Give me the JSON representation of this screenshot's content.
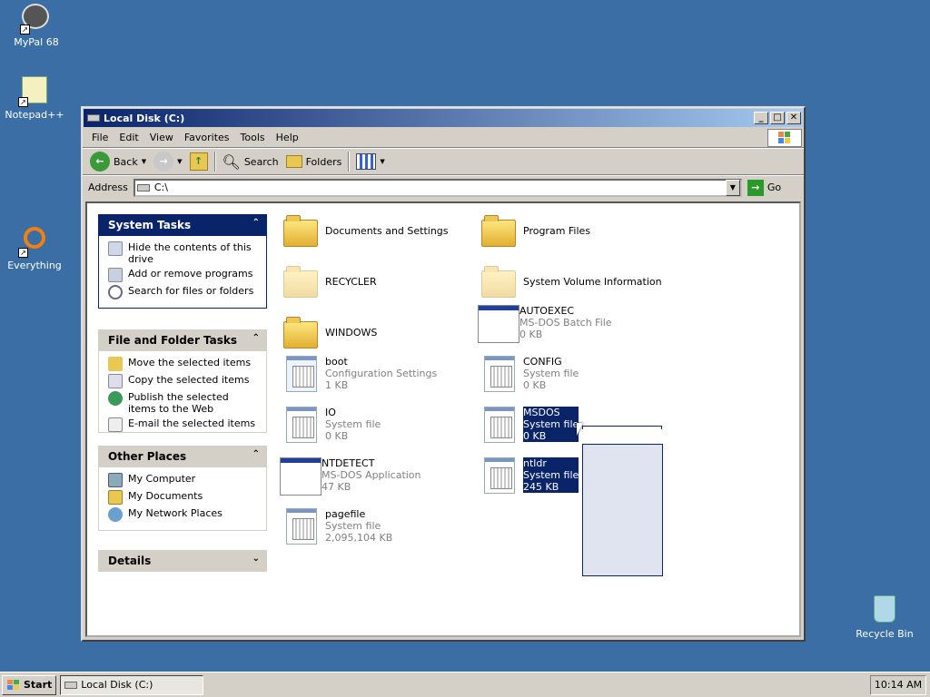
{
  "desktop": {
    "icons": [
      {
        "label": "MyPal 68"
      },
      {
        "label": "Notepad++"
      },
      {
        "label": "Everything"
      },
      {
        "label": "Recycle Bin"
      }
    ]
  },
  "window": {
    "title": "Local Disk (C:)",
    "controls": {
      "minimize": "_",
      "maximize": "□",
      "close": "✕"
    },
    "menu": [
      "File",
      "Edit",
      "View",
      "Favorites",
      "Tools",
      "Help"
    ],
    "toolbar": {
      "back": "Back",
      "search": "Search",
      "folders": "Folders"
    },
    "address": {
      "label": "Address",
      "value": "C:\\",
      "go": "Go"
    }
  },
  "sidebar": {
    "system_tasks": {
      "title": "System Tasks",
      "items": [
        "Hide the contents of this drive",
        "Add or remove programs",
        "Search for files or folders"
      ]
    },
    "file_folder_tasks": {
      "title": "File and Folder Tasks",
      "items": [
        "Move the selected items",
        "Copy the selected items",
        "Publish the selected items to the Web",
        "E-mail the selected items"
      ]
    },
    "other_places": {
      "title": "Other Places",
      "items": [
        "My Computer",
        "My Documents",
        "My Network Places"
      ]
    },
    "details": {
      "title": "Details"
    }
  },
  "files": [
    {
      "name": "Documents and Settings"
    },
    {
      "name": "Program Files"
    },
    {
      "name": "RECYCLER"
    },
    {
      "name": "System Volume Information"
    },
    {
      "name": "WINDOWS"
    },
    {
      "name": "AUTOEXEC",
      "type": "MS-DOS Batch File",
      "size": "0 KB"
    },
    {
      "name": "boot",
      "type": "Configuration Settings",
      "size": "1 KB"
    },
    {
      "name": "CONFIG",
      "type": "System file",
      "size": "0 KB"
    },
    {
      "name": "IO",
      "type": "System file",
      "size": "0 KB"
    },
    {
      "name": "MSDOS",
      "type": "System file",
      "size": "0 KB"
    },
    {
      "name": "NTDETECT",
      "type": "MS-DOS Application",
      "size": "47 KB"
    },
    {
      "name": "ntldr",
      "type": "System file",
      "size": "245 KB"
    },
    {
      "name": "pagefile",
      "type": "System file",
      "size": "2,095,104 KB"
    }
  ],
  "taskbar": {
    "start": "Start",
    "task": "Local Disk (C:)",
    "clock": "10:14 AM"
  }
}
